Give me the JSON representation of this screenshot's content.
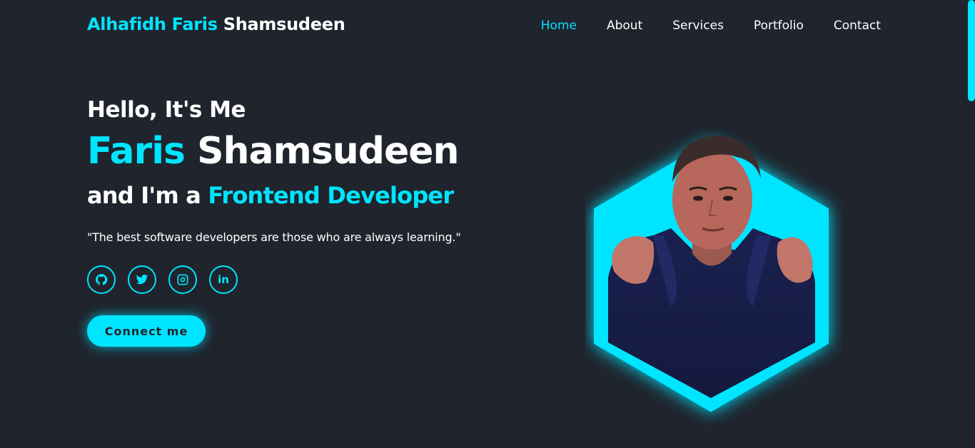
{
  "header": {
    "logo_accent": "Alhafidh Faris",
    "logo_plain": " Shamsudeen",
    "nav": [
      {
        "label": "Home",
        "active": true
      },
      {
        "label": "About",
        "active": false
      },
      {
        "label": "Services",
        "active": false
      },
      {
        "label": "Portfolio",
        "active": false
      },
      {
        "label": "Contact",
        "active": false
      }
    ]
  },
  "hero": {
    "greeting": "Hello, It's Me",
    "name_accent": "Faris",
    "name_plain": " Shamsudeen",
    "role_prefix": "and I'm a ",
    "role_accent": "Frontend Developer",
    "quote": "\"The best software developers are those who are always learning.\"",
    "socials": [
      {
        "icon": "github-icon"
      },
      {
        "icon": "twitter-icon"
      },
      {
        "icon": "instagram-icon"
      },
      {
        "icon": "linkedin-icon",
        "text": "in"
      }
    ],
    "cta_label": "Connect me"
  },
  "colors": {
    "background": "#1f242d",
    "accent": "#00e5ff",
    "text": "#ffffff"
  }
}
